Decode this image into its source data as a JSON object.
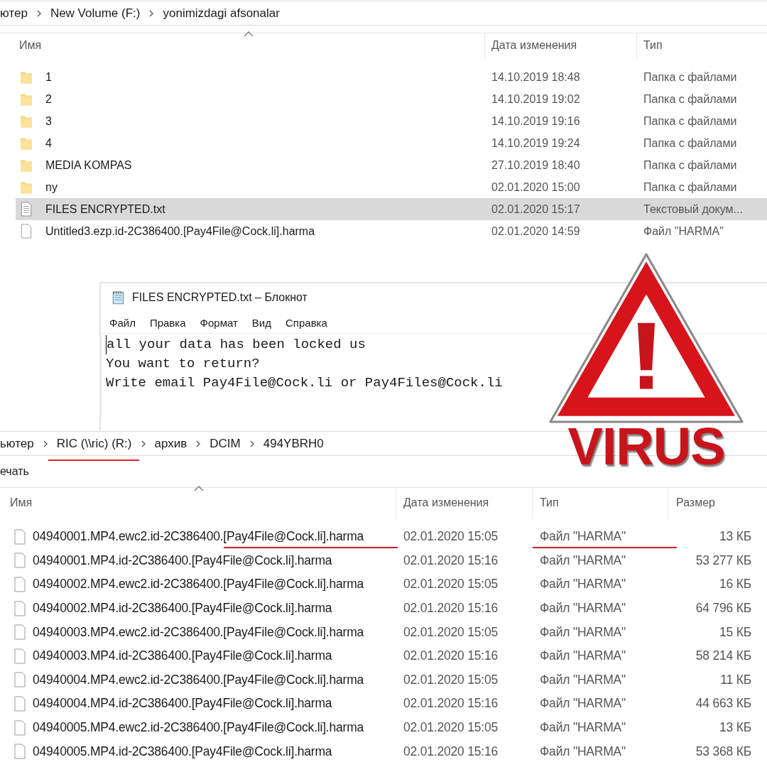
{
  "top_explorer": {
    "breadcrumb": [
      {
        "label": "ютер"
      },
      {
        "label": "New Volume (F:)"
      },
      {
        "label": "yonimizdagi afsonalar"
      }
    ],
    "columns": [
      "Имя",
      "Дата изменения",
      "Тип"
    ],
    "rows": [
      {
        "kind": "folder",
        "name": "1",
        "date": "14.10.2019 18:48",
        "type": "Папка с файлами",
        "selected": false
      },
      {
        "kind": "folder",
        "name": "2",
        "date": "14.10.2019 19:02",
        "type": "Папка с файлами",
        "selected": false
      },
      {
        "kind": "folder",
        "name": "3",
        "date": "14.10.2019 19:16",
        "type": "Папка с файлами",
        "selected": false
      },
      {
        "kind": "folder",
        "name": "4",
        "date": "14.10.2019 19:24",
        "type": "Папка с файлами",
        "selected": false
      },
      {
        "kind": "folder",
        "name": "MEDIA KOMPAS",
        "date": "27.10.2019 18:40",
        "type": "Папка с файлами",
        "selected": false
      },
      {
        "kind": "folder",
        "name": "ny",
        "date": "02.01.2020 15:00",
        "type": "Папка с файлами",
        "selected": false
      },
      {
        "kind": "text",
        "name": "FILES ENCRYPTED.txt",
        "date": "02.01.2020 15:17",
        "type": "Текстовый докум...",
        "selected": true
      },
      {
        "kind": "file",
        "name": "Untitled3.ezp.id-2C386400.[Pay4File@Cock.li].harma",
        "date": "02.01.2020 14:59",
        "type": "Файл \"HARMA\"",
        "selected": false
      }
    ]
  },
  "notepad": {
    "title": "FILES ENCRYPTED.txt – Блокнот",
    "menu": [
      "Файл",
      "Правка",
      "Формат",
      "Вид",
      "Справка"
    ],
    "lines": [
      "all your data has been locked us",
      "You want to return?",
      "Write email Pay4File@Cock.li or Pay4Files@Cock.li"
    ]
  },
  "bottom_explorer": {
    "breadcrumb": [
      {
        "label": "ьютер",
        "underlined": false
      },
      {
        "label": "RIC (\\\\ric) (R:)",
        "underlined": true
      },
      {
        "label": "архив",
        "underlined": false
      },
      {
        "label": "DCIM",
        "underlined": false
      },
      {
        "label": "494YBRH0",
        "underlined": false
      }
    ],
    "ribbon_label": "ечать",
    "columns": [
      "Имя",
      "Дата изменения",
      "Тип",
      "Размер"
    ],
    "rows": [
      {
        "name": "04940001.MP4.ewc2.id-2C386400.[Pay4File@Cock.li].harma",
        "date": "02.01.2020 15:05",
        "type": "Файл \"HARMA\"",
        "size": "13 КБ",
        "underlined": true
      },
      {
        "name": "04940001.MP4.id-2C386400.[Pay4File@Cock.li].harma",
        "date": "02.01.2020 15:16",
        "type": "Файл \"HARMA\"",
        "size": "53 277 КБ",
        "underlined": false
      },
      {
        "name": "04940002.MP4.ewc2.id-2C386400.[Pay4File@Cock.li].harma",
        "date": "02.01.2020 15:05",
        "type": "Файл \"HARMA\"",
        "size": "16 КБ",
        "underlined": false
      },
      {
        "name": "04940002.MP4.id-2C386400.[Pay4File@Cock.li].harma",
        "date": "02.01.2020 15:16",
        "type": "Файл \"HARMA\"",
        "size": "64 796 КБ",
        "underlined": false
      },
      {
        "name": "04940003.MP4.ewc2.id-2C386400.[Pay4File@Cock.li].harma",
        "date": "02.01.2020 15:05",
        "type": "Файл \"HARMA\"",
        "size": "15 КБ",
        "underlined": false
      },
      {
        "name": "04940003.MP4.id-2C386400.[Pay4File@Cock.li].harma",
        "date": "02.01.2020 15:16",
        "type": "Файл \"HARMA\"",
        "size": "58 214 КБ",
        "underlined": false
      },
      {
        "name": "04940004.MP4.ewc2.id-2C386400.[Pay4File@Cock.li].harma",
        "date": "02.01.2020 15:05",
        "type": "Файл \"HARMA\"",
        "size": "11 КБ",
        "underlined": false
      },
      {
        "name": "04940004.MP4.id-2C386400.[Pay4File@Cock.li].harma",
        "date": "02.01.2020 15:16",
        "type": "Файл \"HARMA\"",
        "size": "44 663 КБ",
        "underlined": false
      },
      {
        "name": "04940005.MP4.ewc2.id-2C386400.[Pay4File@Cock.li].harma",
        "date": "02.01.2020 15:05",
        "type": "Файл \"HARMA\"",
        "size": "13 КБ",
        "underlined": false
      },
      {
        "name": "04940005.MP4.id-2C386400.[Pay4File@Cock.li].harma",
        "date": "02.01.2020 15:16",
        "type": "Файл \"HARMA\"",
        "size": "53 368 КБ",
        "underlined": false
      }
    ]
  },
  "warning_sign": {
    "label": "VIRUS"
  }
}
